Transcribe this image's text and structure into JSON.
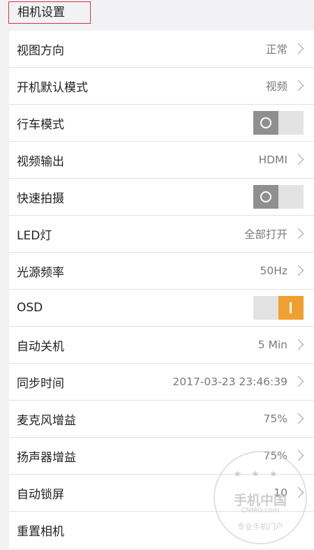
{
  "header": {
    "title": "相机设置"
  },
  "rows": [
    {
      "label": "视图方向",
      "value": "正常"
    },
    {
      "label": "开机默认模式",
      "value": "视频"
    },
    {
      "label": "行车模式",
      "toggle": "off"
    },
    {
      "label": "视频输出",
      "value": "HDMI"
    },
    {
      "label": "快速拍摄",
      "toggle": "off"
    },
    {
      "label": "LED灯",
      "value": "全部打开"
    },
    {
      "label": "光源频率",
      "value": "50Hz"
    },
    {
      "label": "OSD",
      "toggle": "on"
    },
    {
      "label": "自动关机",
      "value": "5 Min"
    },
    {
      "label": "同步时间",
      "value": "2017-03-23 23:46:39"
    },
    {
      "label": "麦克风增益",
      "value": "75%"
    },
    {
      "label": "扬声器增益",
      "value": "75%"
    },
    {
      "label": "自动锁屏",
      "value": "10"
    },
    {
      "label": "重置相机"
    }
  ],
  "watermark": {
    "main": "手机中国",
    "sub": "CNMO.com",
    "foot": "专业手机门户"
  },
  "colors": {
    "accent": "#f0a030",
    "header_border": "#d9343c"
  }
}
